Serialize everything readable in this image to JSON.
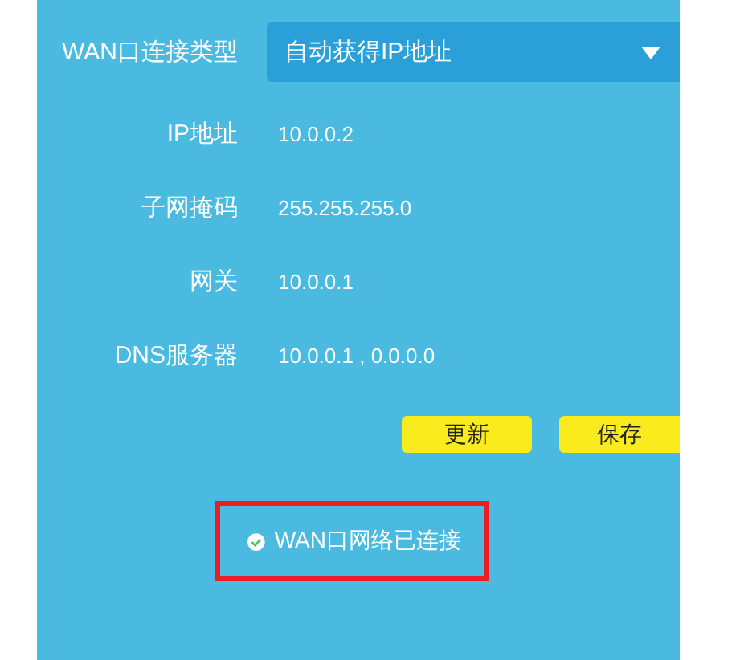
{
  "connection_type": {
    "label": "WAN口连接类型",
    "value": "自动获得IP地址"
  },
  "fields": [
    {
      "label": "IP地址",
      "value": "10.0.0.2"
    },
    {
      "label": "子网掩码",
      "value": "255.255.255.0"
    },
    {
      "label": "网关",
      "value": "10.0.0.1"
    },
    {
      "label": "DNS服务器",
      "value": "10.0.0.1 , 0.0.0.0"
    }
  ],
  "buttons": [
    "更新",
    "保存"
  ],
  "status": {
    "text": "WAN口网络已连接",
    "connected": true,
    "highlighted": true
  }
}
